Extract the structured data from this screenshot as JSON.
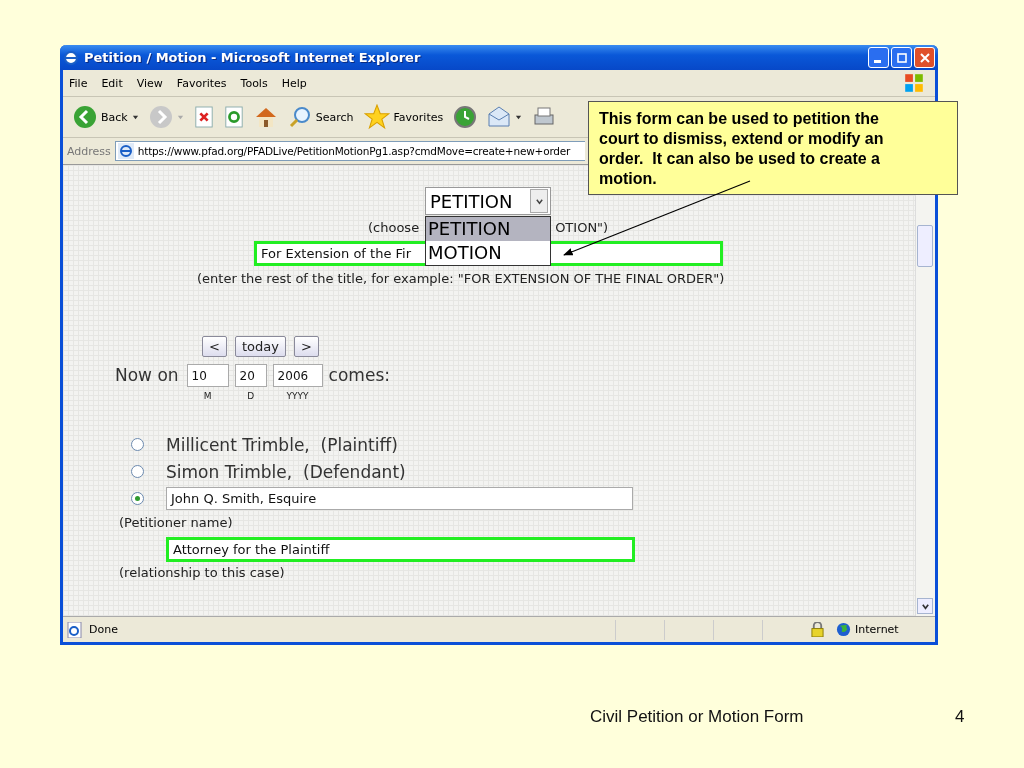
{
  "window": {
    "title": "Petition / Motion - Microsoft Internet Explorer"
  },
  "menu": [
    "File",
    "Edit",
    "View",
    "Favorites",
    "Tools",
    "Help"
  ],
  "toolbar": [
    {
      "kind": "back",
      "label": "Back"
    },
    {
      "kind": "forward"
    },
    {
      "kind": "stop"
    },
    {
      "kind": "refresh"
    },
    {
      "kind": "home"
    },
    {
      "kind": "search",
      "label": "Search"
    },
    {
      "kind": "favorites",
      "label": "Favorites"
    },
    {
      "kind": "history"
    },
    {
      "kind": "mail"
    },
    {
      "kind": "print"
    }
  ],
  "address": {
    "label": "Address",
    "url": "https://www.pfad.org/PFADLive/PetitionMotionPg1.asp?cmdMove=create+new+order"
  },
  "form": {
    "type_select": {
      "value": "PETITION",
      "expanded": true,
      "options": [
        {
          "label": "PETITION",
          "selected": true
        },
        {
          "label": "MOTION",
          "selected": false
        }
      ]
    },
    "type_hint": [
      "(choose",
      "OTION\")"
    ],
    "title_field": {
      "value": "For Extension of the Fir",
      "highlighted": true
    },
    "title_hint": "(enter the rest of the title, for example: \"FOR EXTENSION OF THE FINAL ORDER\")",
    "date_buttons": [
      "<",
      "today",
      ">"
    ],
    "date_label": "Now on",
    "date_fields": [
      {
        "value": "10",
        "caption": "M"
      },
      {
        "value": "20",
        "caption": "D"
      },
      {
        "value": "2006",
        "caption": "YYYY"
      }
    ],
    "date_suffix": "comes:",
    "parties": [
      {
        "kind": "label",
        "text": "Millicent Trimble,  (Plaintiff)",
        "selected": false
      },
      {
        "kind": "label",
        "text": "Simon Trimble,  (Defendant)",
        "selected": false
      },
      {
        "kind": "field",
        "value": "John Q. Smith, Esquire",
        "selected": true
      }
    ],
    "petitioner_hint": "(Petitioner name)",
    "relationship_field": {
      "value": "Attorney for the Plaintiff",
      "highlighted": true
    },
    "relationship_hint": "(relationship to this case)"
  },
  "status_bar": {
    "text": "Done",
    "zone": "Internet"
  },
  "callout": {
    "text": "This form can be used to petition the court to dismiss, extend or modify an order.  It can also be used to create a motion."
  },
  "slide": {
    "footer": "Civil Petition or Motion Form",
    "page_number": "4"
  }
}
